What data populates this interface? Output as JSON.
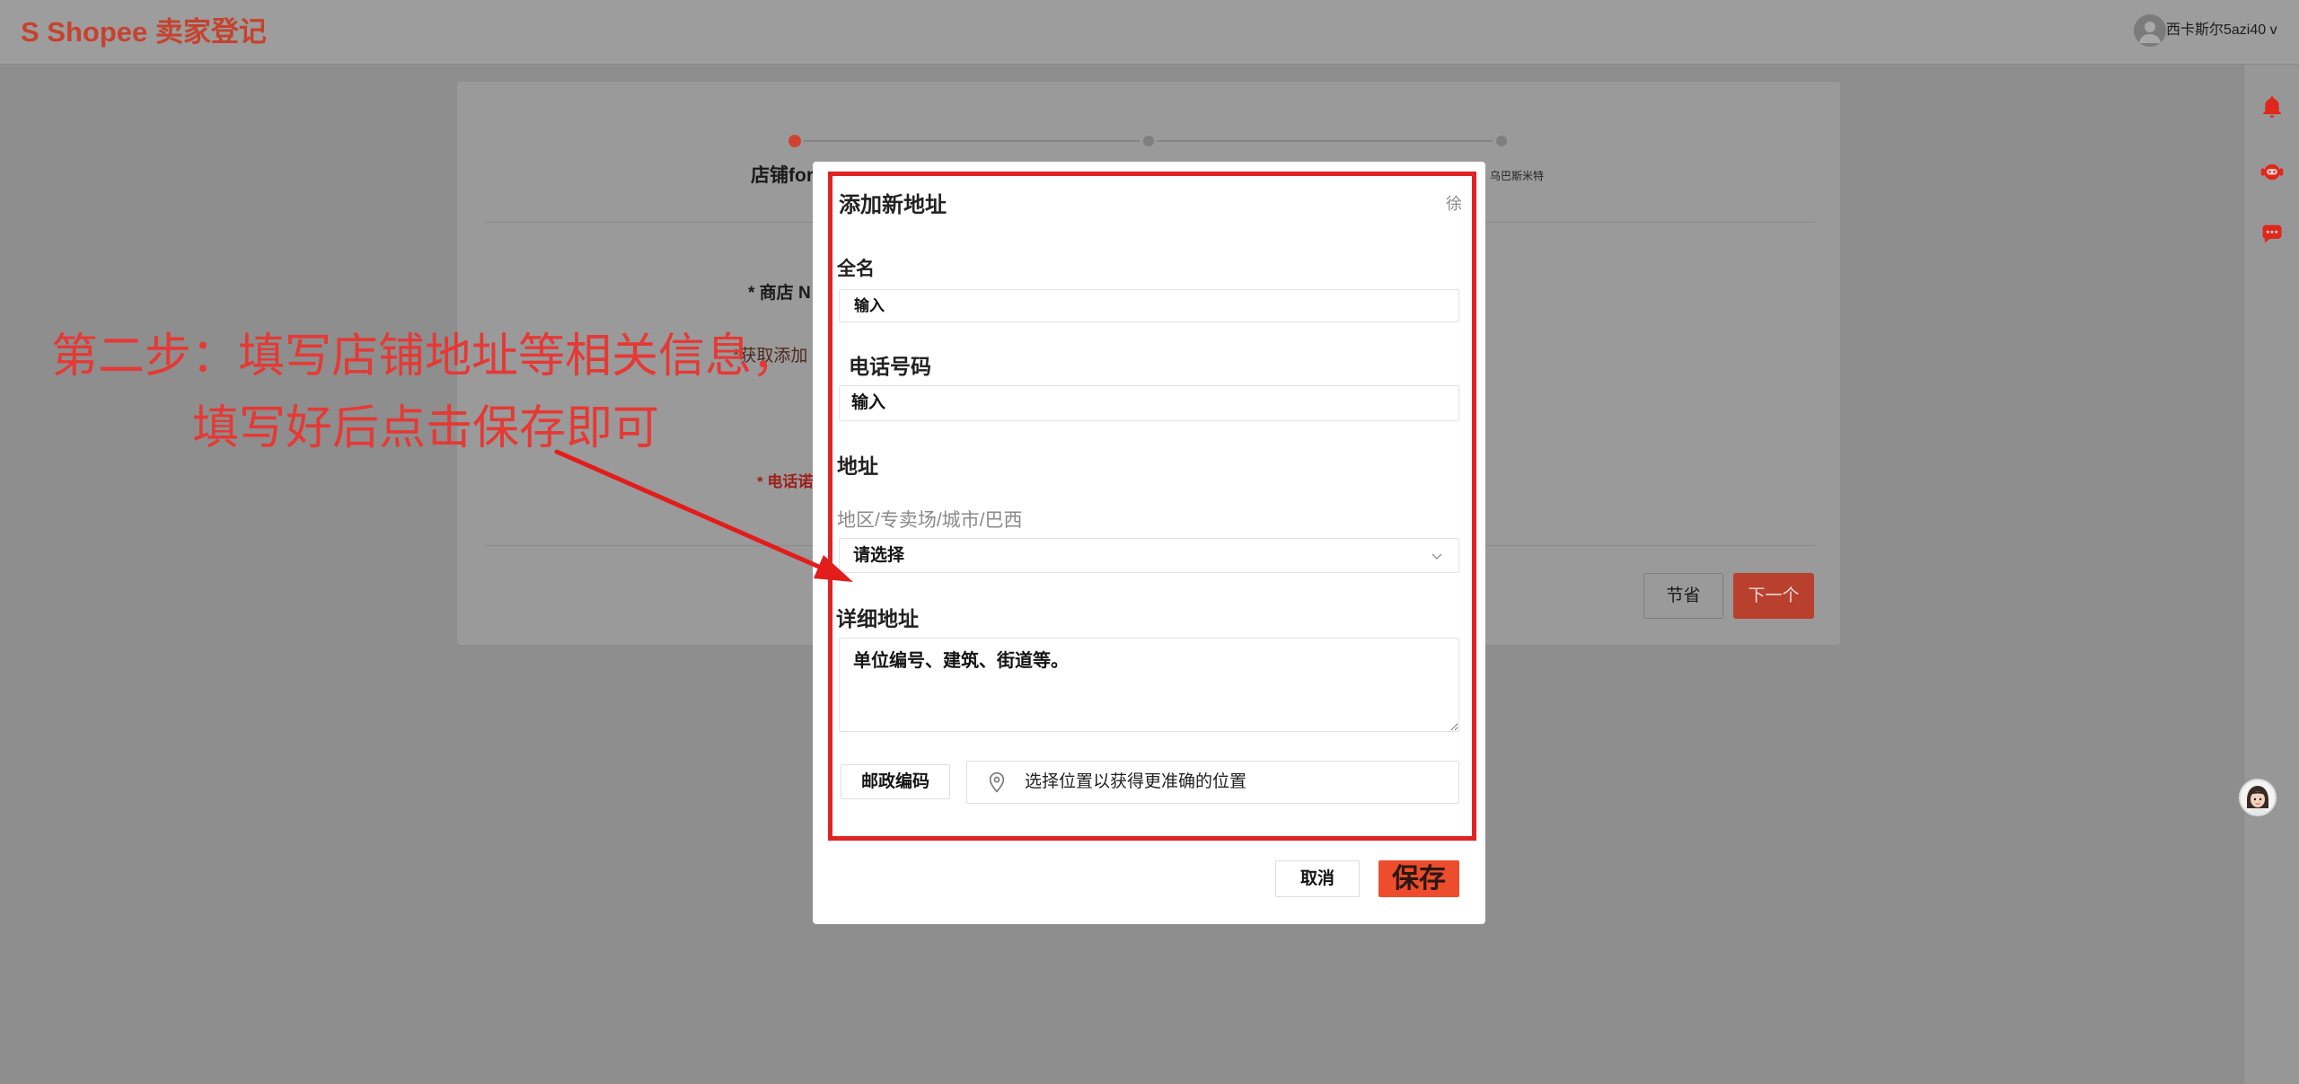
{
  "colors": {
    "brand": "#ee4d2d",
    "annotation": "#e53935",
    "sidebar_icon": "#e0271c"
  },
  "header": {
    "logo_text": "S Shopee 卖家登记",
    "user_name": "西卡斯尔5azi40 v",
    "user_avatar_icon": "user-avatar-icon"
  },
  "sidebar": {
    "icons": [
      "bell-icon",
      "customer-service-icon",
      "chat-icon"
    ],
    "floating_assistant_icon": "assistant-avatar-icon"
  },
  "stepper": {
    "steps": [
      {
        "label": "店铺for",
        "active": true
      },
      {
        "active": false
      },
      {
        "label": "乌巴斯米特",
        "active": false
      }
    ]
  },
  "shop_form": {
    "shop_name_label": "* 商店 N",
    "pickup_address_label": "*获取添加",
    "phone_label": "* 电话诺",
    "save_button": "节省",
    "next_button": "下一个"
  },
  "address_modal": {
    "title": "添加新地址",
    "close_label": "徐",
    "full_name": {
      "label": "全名",
      "placeholder": "输入"
    },
    "phone": {
      "label": "电话号码",
      "placeholder": "输入"
    },
    "address": {
      "section_label": "地址",
      "region_label": "地区/专卖场/城市/巴西",
      "region_select_value": "请选择",
      "detail_label": "详细地址",
      "detail_placeholder": "单位编号、建筑、街道等。",
      "postal_code_button": "邮政编码",
      "location_picker_text": "选择位置以获得更准确的位置"
    },
    "cancel_button": "取消",
    "save_button": "保存"
  },
  "annotation": {
    "line1": "第二步：填写店铺地址等相关信息，",
    "line2": "填写好后点击保存即可"
  }
}
